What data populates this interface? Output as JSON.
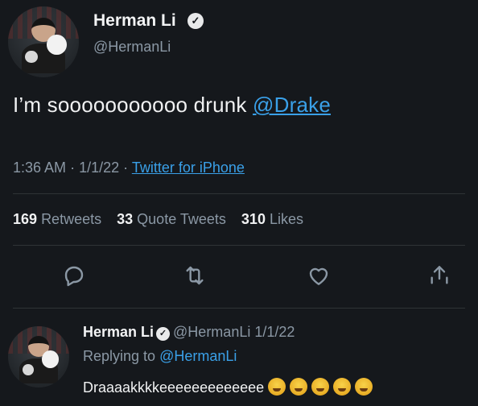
{
  "tweet": {
    "author_name": "Herman Li",
    "author_handle": "@HermanLi",
    "text_prefix": "I’m sooooooooooo drunk ",
    "mention": "@Drake",
    "time": "1:36 AM",
    "date": "1/1/22",
    "separator": "·",
    "source": "Twitter for iPhone",
    "stats": {
      "retweets_count": "169",
      "retweets_label": "Retweets",
      "quotes_count": "33",
      "quotes_label": "Quote Tweets",
      "likes_count": "310",
      "likes_label": "Likes"
    }
  },
  "actions": [
    {
      "name": "reply-icon"
    },
    {
      "name": "retweet-icon"
    },
    {
      "name": "like-icon"
    },
    {
      "name": "share-icon"
    }
  ],
  "reply": {
    "author_name": "Herman Li",
    "author_handle": "@HermanLi",
    "date": "1/1/22",
    "replying_prefix": "Replying to",
    "replying_to": "@HermanLi",
    "text": "Draaaakkkkeeeeeeeeeeeee",
    "emoji_count": 5
  },
  "colors": {
    "background": "#15181c",
    "link": "#3aa0e8",
    "muted": "#8b98a5"
  }
}
